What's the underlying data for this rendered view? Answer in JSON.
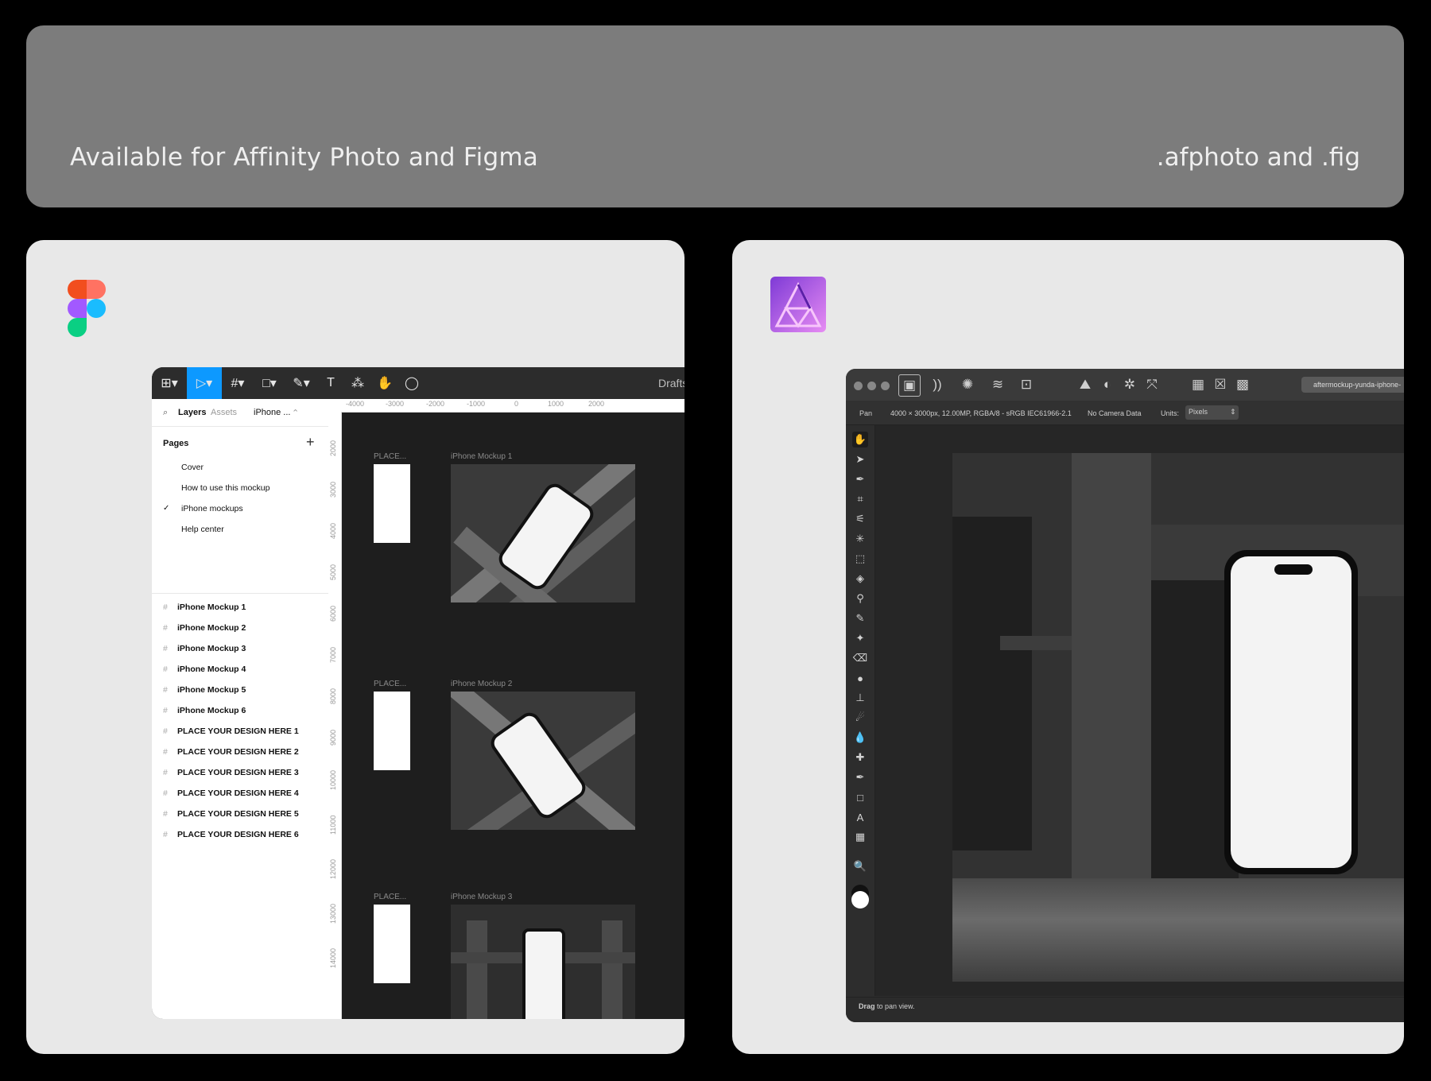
{
  "banner": {
    "left_text": "Available for Affinity Photo and Figma",
    "right_text": ".afphoto and .fig"
  },
  "figma": {
    "title": "Drafts",
    "tabs": {
      "layers": "Layers",
      "assets": "Assets",
      "page": "iPhone ...",
      "page_chevron": "⌃"
    },
    "pages_header": "Pages",
    "add_page": "+",
    "pages": [
      "Cover",
      "How to use this mockup",
      "iPhone mockups",
      "Help center"
    ],
    "current_check": "✓",
    "layers": [
      "iPhone Mockup 1",
      "iPhone Mockup 2",
      "iPhone Mockup 3",
      "iPhone Mockup 4",
      "iPhone Mockup 5",
      "iPhone Mockup 6",
      "PLACE YOUR DESIGN HERE 1",
      "PLACE YOUR DESIGN HERE 2",
      "PLACE YOUR DESIGN HERE 3",
      "PLACE YOUR DESIGN HERE 4",
      "PLACE YOUR DESIGN HERE 5",
      "PLACE YOUR DESIGN HERE 6"
    ],
    "ruler_x": [
      "-4000",
      "-3000",
      "-2000",
      "-1000",
      "0",
      "1000",
      "2000"
    ],
    "ruler_y": [
      "2000",
      "3000",
      "4000",
      "5000",
      "6000",
      "7000",
      "8000",
      "9000",
      "10000",
      "11000",
      "12000",
      "13000",
      "14000"
    ],
    "frames": [
      {
        "place_label": "PLACE...",
        "mock_label": "iPhone Mockup 1"
      },
      {
        "place_label": "PLACE...",
        "mock_label": "iPhone Mockup 2"
      },
      {
        "place_label": "PLACE...",
        "mock_label": "iPhone Mockup 3"
      }
    ]
  },
  "affinity": {
    "file_name": "aftermockup-yunda-iphone-",
    "context": {
      "tool": "Pan",
      "doc_info": "4000 × 3000px, 12.00MP, RGBA/8 - sRGB IEC61966-2.1",
      "camera": "No Camera Data",
      "units_label": "Units:",
      "units_value": "Pixels"
    },
    "status": {
      "bold": "Drag",
      "rest": " to pan view."
    }
  },
  "colors": {
    "figma_blue": "#0d99ff",
    "affinity_purple": "#7e3ad6"
  }
}
